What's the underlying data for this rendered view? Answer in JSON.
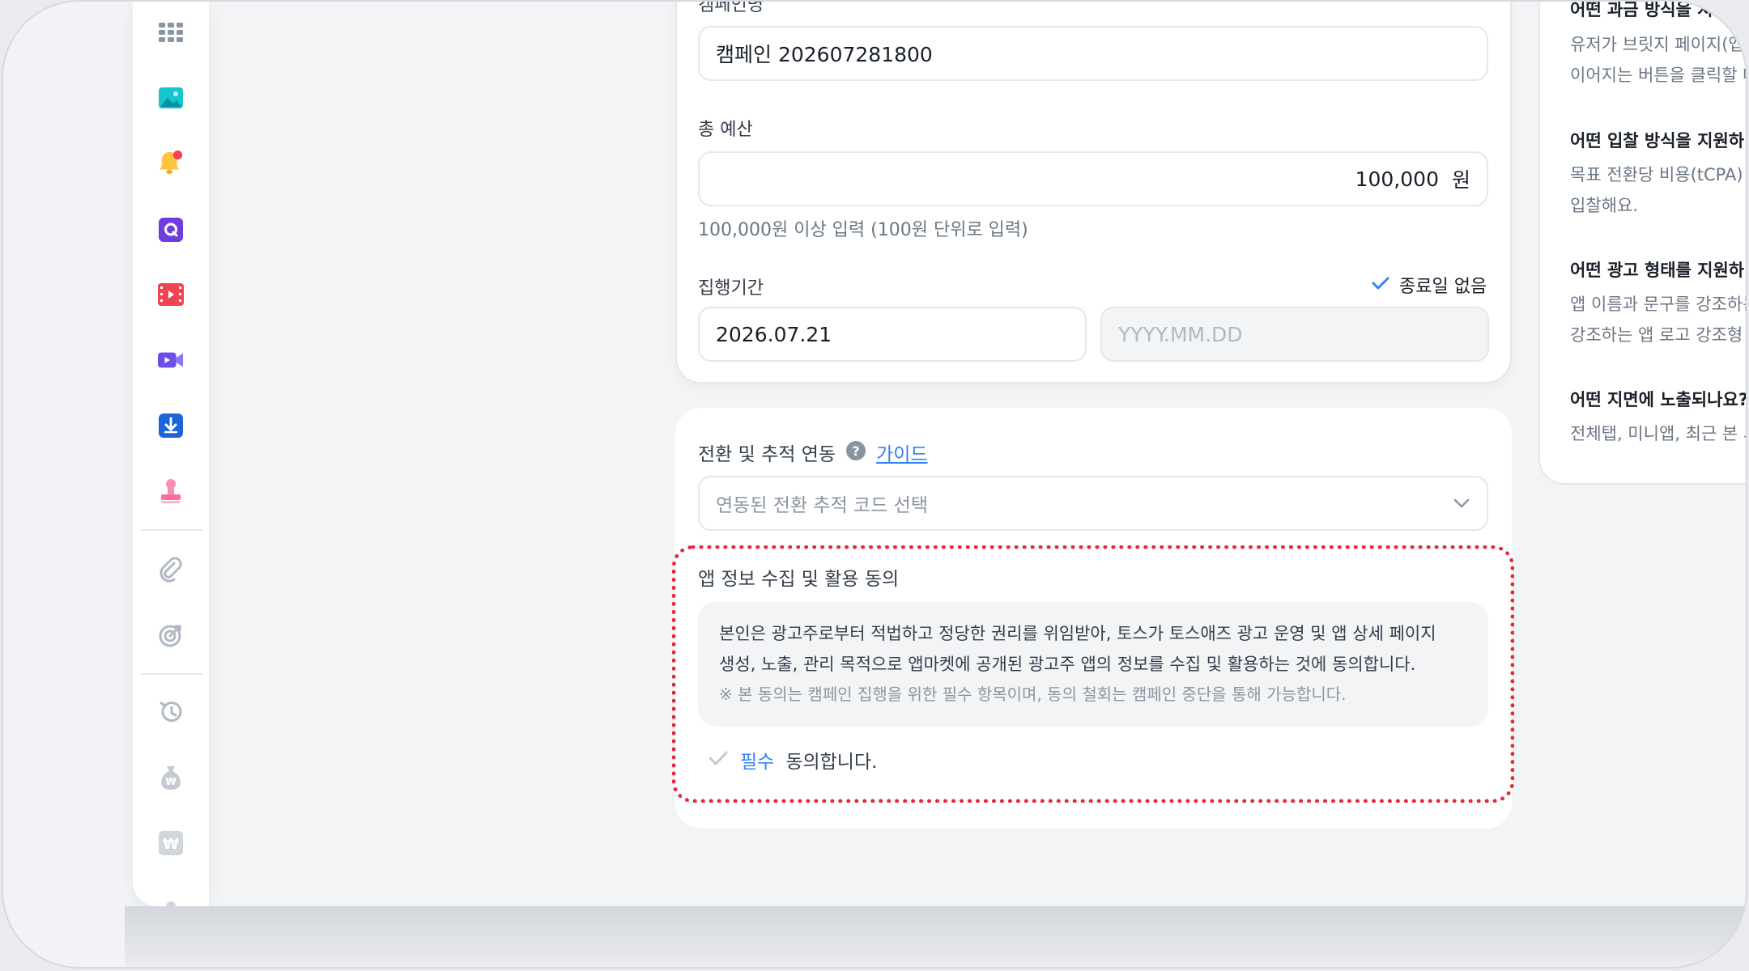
{
  "campaign_form": {
    "name_label": "캠페인명",
    "name_value": "캠페인 202607281800",
    "budget_label": "총 예산",
    "budget_value": "100,000",
    "budget_unit": "원",
    "budget_hint": "100,000원 이상 입력 (100원 단위로 입력)",
    "period_label": "집행기간",
    "no_end_date_label": "종료일 없음",
    "start_date_value": "2026.07.21",
    "end_date_placeholder": "YYYY.MM.DD"
  },
  "tracking": {
    "title": "전환 및 추적 연동",
    "help_icon": "question-circle-icon",
    "guide_link": "가이드",
    "select_placeholder": "연동된 전환 추적 코드 선택"
  },
  "consent": {
    "title": "앱 정보 수집 및 활용 동의",
    "body_line1": "본인은 광고주로부터 적법하고 정당한 권리를 위임받아, 토스가 토스애즈 광고 운영 및 앱 상세 페이지",
    "body_line2": "생성, 노출, 관리 목적으로 앱마켓에 공개된 광고주 앱의 정보를 수집 및 활용하는 것에 동의합니다.",
    "note": "※ 본 동의는 캠페인 집행을 위한 필수 항목이며, 동의 철회는 캠페인 중단을 통해 가능합니다.",
    "required_tag": "필수",
    "agree_label": "동의합니다."
  },
  "faq": {
    "items": [
      {
        "title": "어떤 과금 방식을 지원",
        "text1": "유저가 브릿지 페이지(앱",
        "text2": "이어지는 버튼을 클릭할 때"
      },
      {
        "title": "어떤 입찰 방식을 지원하",
        "text1": "목표 전환당 비용(tCPA)",
        "text2": "입찰해요."
      },
      {
        "title": "어떤 광고 형태를 지원하",
        "text1": "앱 이름과 문구를 강조하는",
        "text2": "강조하는 앱 로고 강조형"
      },
      {
        "title": "어떤 지면에 노출되나요?",
        "text1": "전체탭, 미니앱, 최근 본 서",
        "text2": ""
      }
    ]
  },
  "sidebar": {
    "icons": [
      "grid-icon",
      "image-icon",
      "bell-icon",
      "quiz-icon",
      "film-icon",
      "video-camera-icon",
      "download-icon",
      "stamp-icon",
      "link-icon",
      "target-icon",
      "history-icon",
      "money-bag-icon",
      "won-icon"
    ]
  },
  "colors": {
    "accent": "#3182f6",
    "consent_border": "#e42939",
    "text_primary": "#191f28",
    "text_secondary": "#6b7684"
  }
}
